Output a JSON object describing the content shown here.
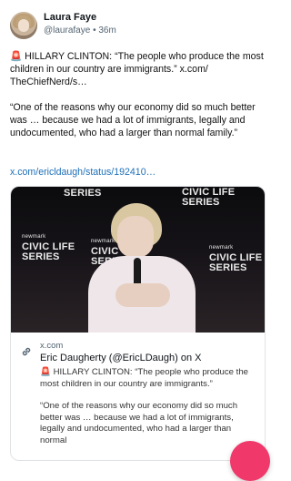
{
  "author": {
    "name": "Laura Faye",
    "handle": "@laurafaye",
    "separator": "•",
    "time": "36m"
  },
  "post": {
    "alarm_emoji": "🚨",
    "paragraph1": "HILLARY CLINTON: “The people who produce the most children in our country are immigrants.” x.com/\nTheChiefNerd/s…",
    "paragraph2": "“One of the reasons why our economy did so much better was … because we had a lot of immigrants, legally and undocumented, who had a larger than normal family.”",
    "link": "x.com/ericldaugh/status/192410…"
  },
  "card": {
    "logos": [
      {
        "small": "newmark",
        "big": "CIVIC LIFE\nSERIES"
      }
    ],
    "domain": "x.com",
    "title": "Eric Daugherty (@EricLDaugh) on X",
    "alarm_emoji": "🚨",
    "desc1": "HILLARY CLINTON: “The people who produce the most children in our country are immigrants.”",
    "desc2": "“One of the reasons why our economy did so much better was … because we had a lot of immigrants, legally and undocumented, who had a larger than normal"
  },
  "icons": {
    "link": "link-icon",
    "compose": "compose-fab"
  },
  "colors": {
    "link": "#1d6fb8",
    "fab": "#f0386b"
  }
}
